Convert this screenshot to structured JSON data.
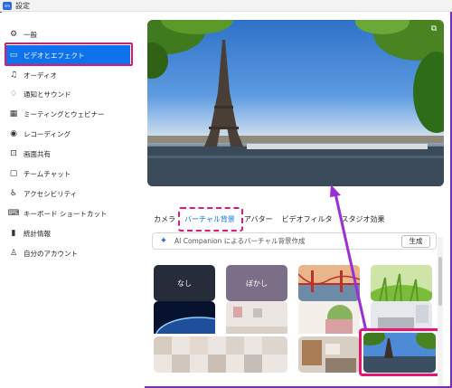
{
  "window": {
    "title": "設定",
    "logo_text": "zm"
  },
  "sidebar": {
    "items": [
      {
        "label": "一般",
        "icon": "gear-icon",
        "glyph": "⚙"
      },
      {
        "label": "ビデオとエフェクト",
        "icon": "video-icon",
        "glyph": "▭"
      },
      {
        "label": "オーディオ",
        "icon": "headphones-icon",
        "glyph": "♫"
      },
      {
        "label": "通知とサウンド",
        "icon": "bell-icon",
        "glyph": "♢"
      },
      {
        "label": "ミーティングとウェビナー",
        "icon": "meeting-icon",
        "glyph": "▦"
      },
      {
        "label": "レコーディング",
        "icon": "record-icon",
        "glyph": "◉"
      },
      {
        "label": "画面共有",
        "icon": "share-screen-icon",
        "glyph": "⊡"
      },
      {
        "label": "チームチャット",
        "icon": "chat-icon",
        "glyph": "▢"
      },
      {
        "label": "アクセシビリティ",
        "icon": "accessibility-icon",
        "glyph": "♿"
      },
      {
        "label": "キーボード ショートカット",
        "icon": "keyboard-icon",
        "glyph": "⌨"
      },
      {
        "label": "統計情報",
        "icon": "stats-icon",
        "glyph": "▮"
      },
      {
        "label": "自分のアカウント",
        "icon": "account-icon",
        "glyph": "♙"
      }
    ],
    "active_index": 1
  },
  "preview": {
    "corner_icon": "expand-icon"
  },
  "tabs": [
    {
      "label": "カメラ"
    },
    {
      "label": "バーチャル背景"
    },
    {
      "label": "アバター"
    },
    {
      "label": "ビデオフィルタ"
    },
    {
      "label": "スタジオ効果"
    }
  ],
  "active_tab_index": 1,
  "ai_bar": {
    "text": "AI Companion によるバーチャル背景作成",
    "button_label": "生成",
    "icon": "ai-sparkle-icon"
  },
  "backgrounds": [
    {
      "name": "none",
      "label": "なし"
    },
    {
      "name": "blur",
      "label": "ぼかし"
    },
    {
      "name": "golden-gate",
      "label": ""
    },
    {
      "name": "grass",
      "label": ""
    },
    {
      "name": "earth",
      "label": ""
    },
    {
      "name": "room-1",
      "label": ""
    },
    {
      "name": "room-2",
      "label": ""
    },
    {
      "name": "living-room",
      "label": ""
    },
    {
      "name": "mosaic",
      "label": ""
    },
    {
      "name": "bookshelf-room",
      "label": ""
    },
    {
      "name": "eiffel",
      "label": ""
    }
  ],
  "selected_background": "eiffel",
  "colors": {
    "accent": "#0e72ed",
    "highlight": "#e01874",
    "arrow": "#9b2fd6",
    "window_border": "#7b2fbf"
  }
}
